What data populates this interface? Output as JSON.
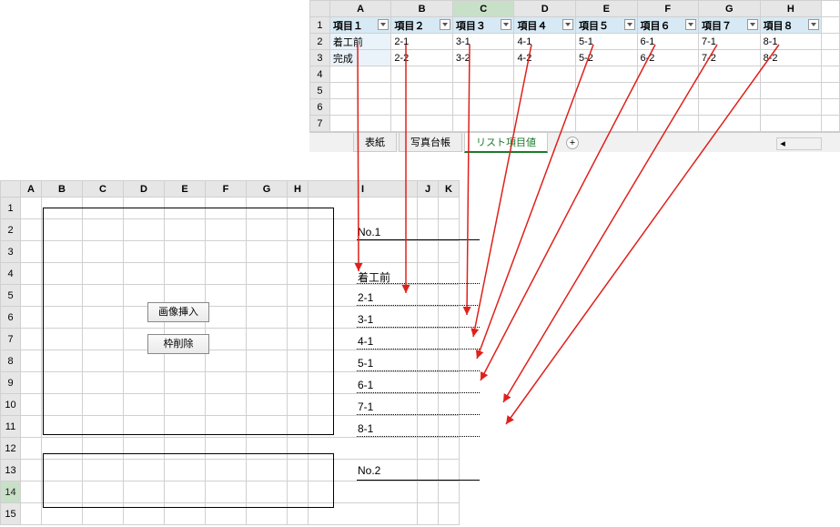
{
  "upper": {
    "cols": [
      "A",
      "B",
      "C",
      "D",
      "E",
      "F",
      "G",
      "H"
    ],
    "selectedCol": "C",
    "header_row": [
      "項目１",
      "項目２",
      "項目３",
      "項目４",
      "項目５",
      "項目６",
      "項目７",
      "項目８"
    ],
    "rows": [
      [
        "着工前",
        "2-1",
        "3-1",
        "4-1",
        "5-1",
        "6-1",
        "7-1",
        "8-1"
      ],
      [
        "完成",
        "2-2",
        "3-2",
        "4-2",
        "5-2",
        "6-2",
        "7-2",
        "8-2"
      ]
    ],
    "tabs": {
      "items": [
        "表紙",
        "写真台帳",
        "リスト項目値"
      ],
      "active": "リスト項目値"
    }
  },
  "lower": {
    "cols": [
      "A",
      "B",
      "C",
      "D",
      "E",
      "F",
      "G",
      "H",
      "I",
      "J",
      "K"
    ],
    "selectedRow": "14",
    "buttons": {
      "insert": "画像挿入",
      "delete": "枠削除"
    },
    "entries": {
      "no1_label": "No.1",
      "list": [
        "着工前",
        "2-1",
        "3-1",
        "4-1",
        "5-1",
        "6-1",
        "7-1",
        "8-1"
      ],
      "no2_label": "No.2"
    }
  }
}
